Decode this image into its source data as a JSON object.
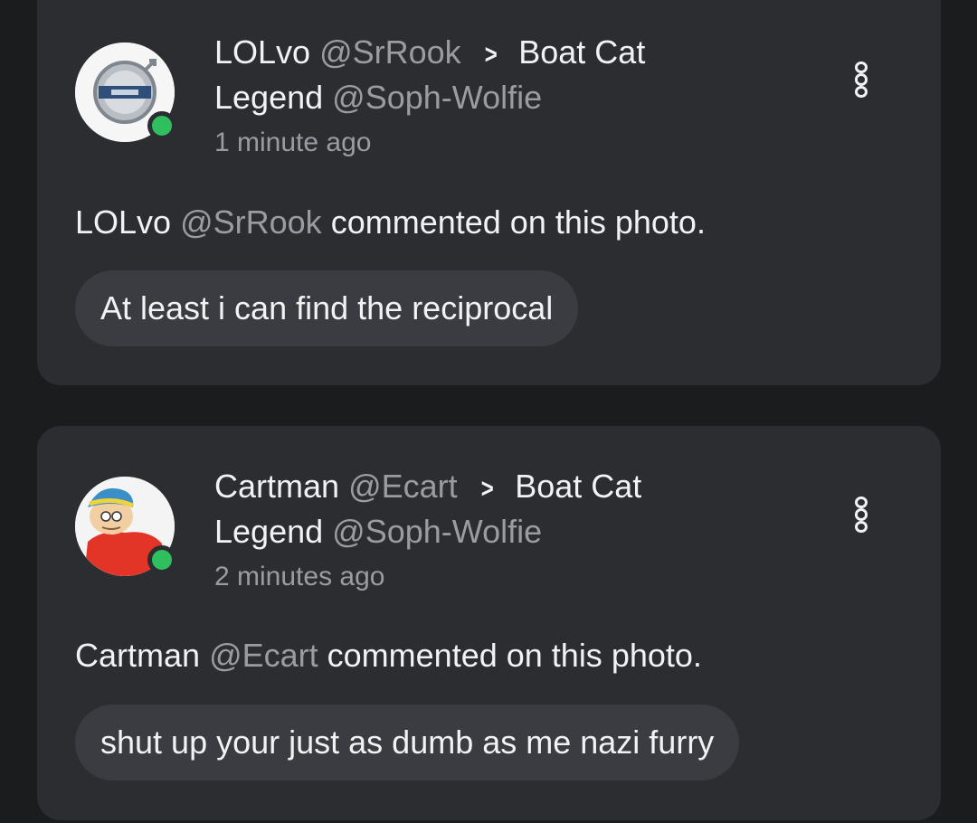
{
  "notifications": [
    {
      "author_name": "LOLvo",
      "author_handle": "@SrRook",
      "target_name_line1": "Boat Cat",
      "target_name_line2": "Legend",
      "target_handle": "@Soph-Wolfie",
      "time": "1 minute ago",
      "activity_name": "LOLvo",
      "activity_handle": "@SrRook",
      "activity_text": "commented on this photo.",
      "comment": "At least i can find the reciprocal",
      "avatar_icon": "volvo-logo-avatar",
      "online": true
    },
    {
      "author_name": "Cartman",
      "author_handle": "@Ecart",
      "target_name_line1": "Boat Cat",
      "target_name_line2": "Legend",
      "target_handle": "@Soph-Wolfie",
      "time": "2 minutes ago",
      "activity_name": "Cartman",
      "activity_handle": "@Ecart",
      "activity_text": "commented on this photo.",
      "comment": "shut up your just as dumb as me nazi furry",
      "avatar_icon": "cartman-avatar",
      "online": true
    }
  ],
  "colors": {
    "background": "#1b1c1e",
    "card": "#2b2d31",
    "bubble": "#3a3c41",
    "muted_text": "#9a9ca1",
    "online": "#2fbf5f"
  },
  "icons": {
    "chevron": "chevron-right-icon",
    "menu": "more-vertical-icon"
  }
}
